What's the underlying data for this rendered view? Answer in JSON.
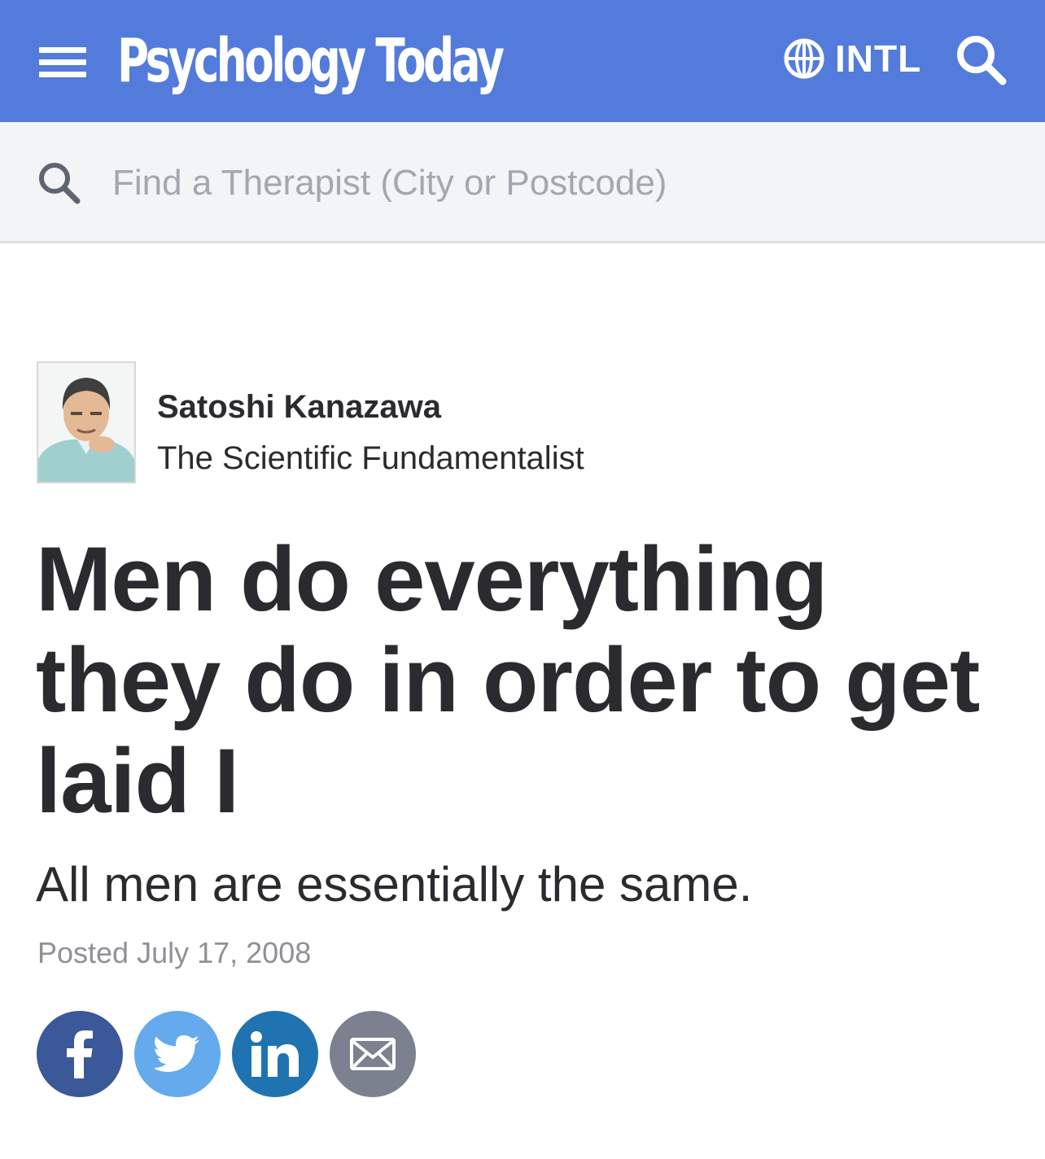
{
  "header": {
    "logo_text": "Psychology Today",
    "intl_label": "INTL",
    "colors": {
      "bar": "#537bdc",
      "text": "#ffffff"
    }
  },
  "find_therapist": {
    "placeholder": "Find a Therapist (City or Postcode)"
  },
  "article": {
    "author_name": "Satoshi Kanazawa",
    "blog_name": "The Scientific Fundamentalist",
    "title": "Men do everything they do in order to get laid I",
    "subtitle": "All men are essentially the same.",
    "posted": "Posted July 17, 2008"
  },
  "share": {
    "icons": [
      "facebook-icon",
      "twitter-icon",
      "linkedin-icon",
      "email-icon"
    ],
    "colors": {
      "facebook": "#3b5998",
      "twitter": "#64aaed",
      "linkedin": "#1f73b0",
      "email": "#7b818f"
    }
  }
}
